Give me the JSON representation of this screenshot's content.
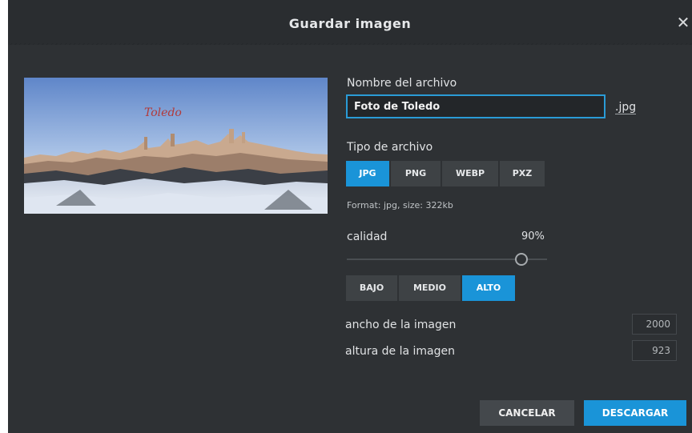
{
  "dialog": {
    "title": "Guardar imagen",
    "close_icon": "close-icon"
  },
  "preview": {
    "overlay_text": "Toledo",
    "overlay_color": "#b23a3a"
  },
  "filename": {
    "label": "Nombre del archivo",
    "value": "Foto de Toledo",
    "extension": ".jpg"
  },
  "filetype": {
    "label": "Tipo de archivo",
    "options": [
      "JPG",
      "PNG",
      "WEBP",
      "PXZ"
    ],
    "selected": "JPG",
    "info": "Format: jpg, size: 322kb"
  },
  "quality": {
    "label": "calidad",
    "value_text": "90%",
    "value": 90,
    "presets": [
      "BAJO",
      "MEDIO",
      "ALTO"
    ],
    "selected_preset": "ALTO"
  },
  "dimensions": {
    "width_label": "ancho de la imagen",
    "width_value": "2000",
    "height_label": "altura de la imagen",
    "height_value": "923"
  },
  "actions": {
    "cancel": "CANCELAR",
    "download": "DESCARGAR"
  },
  "colors": {
    "accent": "#1a94d8",
    "background": "#2e3134"
  }
}
